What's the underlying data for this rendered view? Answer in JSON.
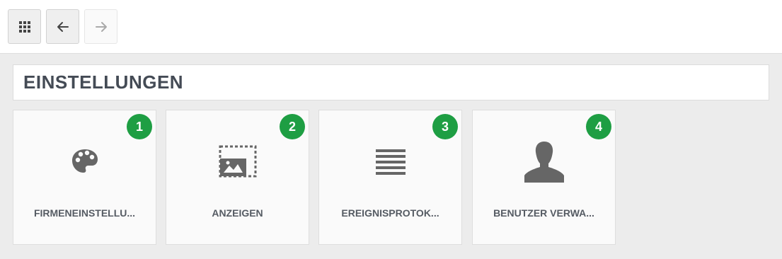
{
  "toolbar": {
    "apps_icon": "grid-icon",
    "back_icon": "arrow-left-icon",
    "forward_icon": "arrow-right-icon"
  },
  "header": {
    "title": "EINSTELLUNGEN"
  },
  "tiles": [
    {
      "badge": "1",
      "label": "FIRMENEINSTELLU...",
      "icon": "palette-icon"
    },
    {
      "badge": "2",
      "label": "ANZEIGEN",
      "icon": "image-frame-icon"
    },
    {
      "badge": "3",
      "label": "EREIGNISPROTOK...",
      "icon": "list-icon"
    },
    {
      "badge": "4",
      "label": "BENUTZER VERWA...",
      "icon": "user-icon"
    }
  ],
  "colors": {
    "badge": "#1e9e43",
    "icon": "#666666",
    "text": "#555b63"
  }
}
